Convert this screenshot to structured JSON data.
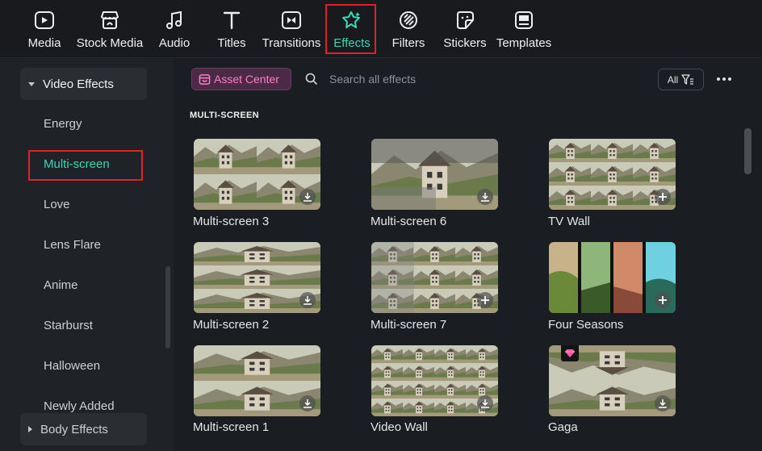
{
  "toolbar": {
    "items": [
      {
        "label": "Media",
        "icon": "media-icon"
      },
      {
        "label": "Stock Media",
        "icon": "stock-media-icon"
      },
      {
        "label": "Audio",
        "icon": "music-note-icon"
      },
      {
        "label": "Titles",
        "icon": "text-t-icon"
      },
      {
        "label": "Transitions",
        "icon": "transitions-icon"
      },
      {
        "label": "Effects",
        "icon": "effects-star-icon"
      },
      {
        "label": "Filters",
        "icon": "filters-icon"
      },
      {
        "label": "Stickers",
        "icon": "sticker-icon"
      },
      {
        "label": "Templates",
        "icon": "templates-icon"
      }
    ],
    "active": "Effects"
  },
  "sidebar": {
    "video_effects_label": "Video Effects",
    "items": [
      "Energy",
      "Multi-screen",
      "Love",
      "Lens Flare",
      "Anime",
      "Starburst",
      "Halloween",
      "Newly Added"
    ],
    "selected": "Multi-screen",
    "body_effects_label": "Body Effects"
  },
  "header": {
    "asset_center_label": "Asset Center",
    "search_placeholder": "Search all effects",
    "filter_label": "All"
  },
  "section_title": "MULTI-SCREEN",
  "effects": [
    {
      "name": "Multi-screen 3",
      "badge": "download"
    },
    {
      "name": "Multi-screen 6",
      "badge": "download"
    },
    {
      "name": "TV Wall",
      "badge": "add"
    },
    {
      "name": "Multi-screen 2",
      "badge": "download"
    },
    {
      "name": "Multi-screen 7",
      "badge": "add"
    },
    {
      "name": "Four Seasons",
      "badge": "add"
    },
    {
      "name": "Multi-screen 1",
      "badge": "download"
    },
    {
      "name": "Video Wall",
      "badge": "download"
    },
    {
      "name": "Gaga",
      "badge": "download",
      "premium": true
    }
  ],
  "colors": {
    "accent": "#37d8b8",
    "highlight": "#e0202a",
    "asset_pink": "#ff7ec9"
  }
}
